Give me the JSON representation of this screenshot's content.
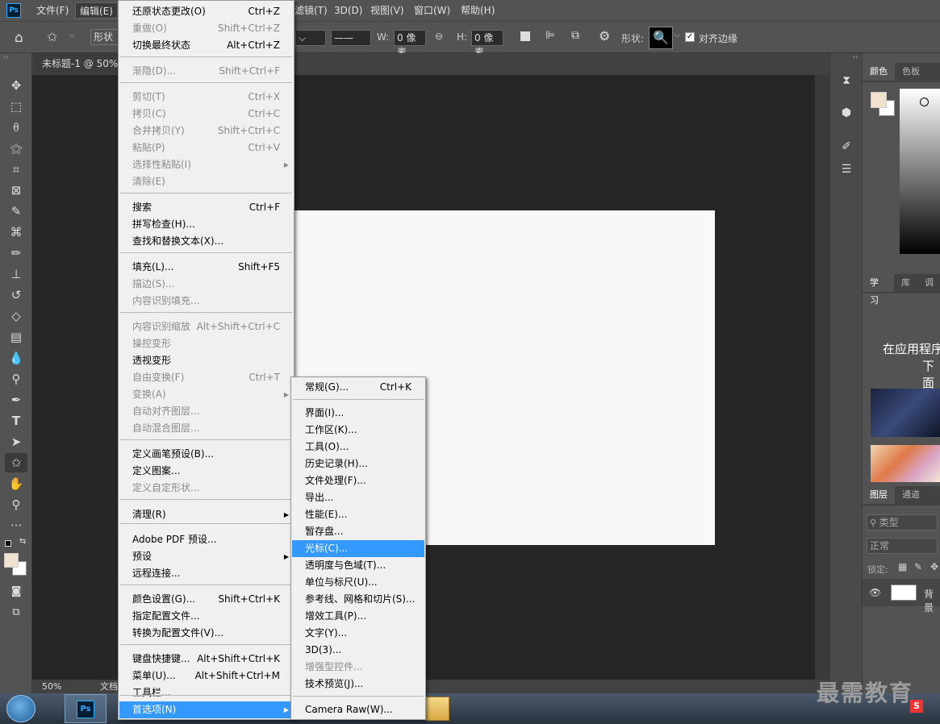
{
  "menubar": {
    "app_icon": "Ps",
    "items": [
      "文件(F)",
      "编辑(E)",
      "滤镜(T)",
      "3D(D)",
      "视图(V)",
      "窗口(W)",
      "帮助(H)"
    ]
  },
  "options": {
    "shape_mode": "形状",
    "w_label": "W:",
    "w_value": "0 像素",
    "h_label": "H:",
    "h_value": "0 像素",
    "shape_label": "形状:",
    "align_edges": "对齐边缘"
  },
  "doc": {
    "tab_title": "未标题-1 @ 50%(",
    "zoom": "50%",
    "status_text": "文档"
  },
  "edit_menu": [
    {
      "label": "还原状态更改(O)",
      "shortcut": "Ctrl+Z",
      "enabled": true
    },
    {
      "label": "重做(O)",
      "shortcut": "Shift+Ctrl+Z",
      "enabled": false
    },
    {
      "label": "切换最终状态",
      "shortcut": "Alt+Ctrl+Z",
      "enabled": true
    },
    {
      "label": "渐隐(D)...",
      "shortcut": "Shift+Ctrl+F",
      "enabled": false
    },
    {
      "label": "剪切(T)",
      "shortcut": "Ctrl+X",
      "enabled": false
    },
    {
      "label": "拷贝(C)",
      "shortcut": "Ctrl+C",
      "enabled": false
    },
    {
      "label": "合并拷贝(Y)",
      "shortcut": "Shift+Ctrl+C",
      "enabled": false
    },
    {
      "label": "粘贴(P)",
      "shortcut": "Ctrl+V",
      "enabled": false
    },
    {
      "label": "选择性粘贴(I)",
      "shortcut": "",
      "enabled": false
    },
    {
      "label": "清除(E)",
      "shortcut": "",
      "enabled": false
    },
    {
      "label": "搜索",
      "shortcut": "Ctrl+F",
      "enabled": true
    },
    {
      "label": "拼写检查(H)...",
      "shortcut": "",
      "enabled": true
    },
    {
      "label": "查找和替换文本(X)...",
      "shortcut": "",
      "enabled": true
    },
    {
      "label": "填充(L)...",
      "shortcut": "Shift+F5",
      "enabled": true
    },
    {
      "label": "描边(S)...",
      "shortcut": "",
      "enabled": false
    },
    {
      "label": "内容识别填充...",
      "shortcut": "",
      "enabled": false
    },
    {
      "label": "内容识别缩放",
      "shortcut": "Alt+Shift+Ctrl+C",
      "enabled": false
    },
    {
      "label": "操控变形",
      "shortcut": "",
      "enabled": false
    },
    {
      "label": "透视变形",
      "shortcut": "",
      "enabled": true
    },
    {
      "label": "自由变换(F)",
      "shortcut": "Ctrl+T",
      "enabled": false
    },
    {
      "label": "变换(A)",
      "shortcut": "",
      "enabled": false
    },
    {
      "label": "自动对齐图层...",
      "shortcut": "",
      "enabled": false
    },
    {
      "label": "自动混合图层...",
      "shortcut": "",
      "enabled": false
    },
    {
      "label": "定义画笔预设(B)...",
      "shortcut": "",
      "enabled": true
    },
    {
      "label": "定义图案...",
      "shortcut": "",
      "enabled": true
    },
    {
      "label": "定义自定形状...",
      "shortcut": "",
      "enabled": false
    },
    {
      "label": "清理(R)",
      "shortcut": "",
      "enabled": true
    },
    {
      "label": "Adobe PDF 预设...",
      "shortcut": "",
      "enabled": true
    },
    {
      "label": "预设",
      "shortcut": "",
      "enabled": true
    },
    {
      "label": "远程连接...",
      "shortcut": "",
      "enabled": true
    },
    {
      "label": "颜色设置(G)...",
      "shortcut": "Shift+Ctrl+K",
      "enabled": true
    },
    {
      "label": "指定配置文件...",
      "shortcut": "",
      "enabled": true
    },
    {
      "label": "转换为配置文件(V)...",
      "shortcut": "",
      "enabled": true
    },
    {
      "label": "键盘快捷键...",
      "shortcut": "Alt+Shift+Ctrl+K",
      "enabled": true
    },
    {
      "label": "菜单(U)...",
      "shortcut": "Alt+Shift+Ctrl+M",
      "enabled": true
    },
    {
      "label": "工具栏...",
      "shortcut": "",
      "enabled": true
    },
    {
      "label": "首选项(N)",
      "shortcut": "",
      "enabled": true
    }
  ],
  "prefs_menu": [
    {
      "label": "常规(G)...",
      "shortcut": "Ctrl+K",
      "enabled": true
    },
    {
      "label": "界面(I)...",
      "shortcut": "",
      "enabled": true
    },
    {
      "label": "工作区(K)...",
      "shortcut": "",
      "enabled": true
    },
    {
      "label": "工具(O)...",
      "shortcut": "",
      "enabled": true
    },
    {
      "label": "历史记录(H)...",
      "shortcut": "",
      "enabled": true
    },
    {
      "label": "文件处理(F)...",
      "shortcut": "",
      "enabled": true
    },
    {
      "label": "导出...",
      "shortcut": "",
      "enabled": true
    },
    {
      "label": "性能(E)...",
      "shortcut": "",
      "enabled": true
    },
    {
      "label": "暂存盘...",
      "shortcut": "",
      "enabled": true
    },
    {
      "label": "光标(C)...",
      "shortcut": "",
      "enabled": true
    },
    {
      "label": "透明度与色域(T)...",
      "shortcut": "",
      "enabled": true
    },
    {
      "label": "单位与标尺(U)...",
      "shortcut": "",
      "enabled": true
    },
    {
      "label": "参考线、网格和切片(S)...",
      "shortcut": "",
      "enabled": true
    },
    {
      "label": "增效工具(P)...",
      "shortcut": "",
      "enabled": true
    },
    {
      "label": "文字(Y)...",
      "shortcut": "",
      "enabled": true
    },
    {
      "label": "3D(3)...",
      "shortcut": "",
      "enabled": true
    },
    {
      "label": "增强型控件...",
      "shortcut": "",
      "enabled": false
    },
    {
      "label": "技术预览(J)...",
      "shortcut": "",
      "enabled": true
    },
    {
      "label": "Camera Raw(W)...",
      "shortcut": "",
      "enabled": true
    }
  ],
  "panels": {
    "color_tabs": [
      "颜色",
      "色板"
    ],
    "learn_tabs": [
      "学习",
      "库",
      "调"
    ],
    "learn_text_1": "在应用程序",
    "learn_text_2": "下面",
    "layer_tabs": [
      "图层",
      "通道"
    ],
    "filter_kind": "类型",
    "blend_mode": "正常",
    "lock_label": "锁定:",
    "layer_name": "背景"
  },
  "watermark": "最需教育",
  "colors": {
    "accent": "#3399ff",
    "ps_blue": "#31a8ff"
  }
}
